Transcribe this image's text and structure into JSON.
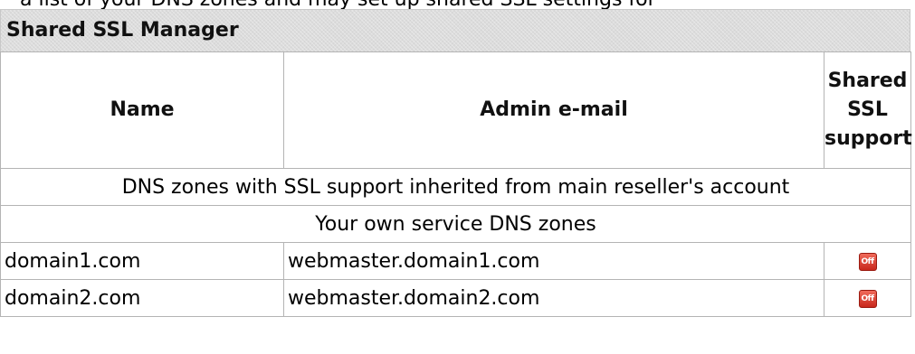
{
  "top_cut_text": "a list of your DNS zones and may set up shared SSL settings for",
  "panel": {
    "title": "Shared SSL Manager"
  },
  "table": {
    "headers": {
      "name": "Name",
      "admin_email": "Admin e-mail",
      "shared_ssl_line1": "Shared",
      "shared_ssl_line2": "SSL",
      "shared_ssl_line3": "support"
    },
    "section_inherited": "DNS zones with SSL support inherited from main reseller's account",
    "section_own": "Your own service DNS zones",
    "rows": [
      {
        "name": "domain1.com",
        "admin_email": "webmaster.domain1.com",
        "status": "Off",
        "status_icon": "off-toggle-icon"
      },
      {
        "name": "domain2.com",
        "admin_email": "webmaster.domain2.com",
        "status": "Off",
        "status_icon": "off-toggle-icon"
      }
    ]
  },
  "colors": {
    "title_bg": "#dcdcdc",
    "border": "#b4b4b4",
    "off_icon": "#d83a2c"
  }
}
